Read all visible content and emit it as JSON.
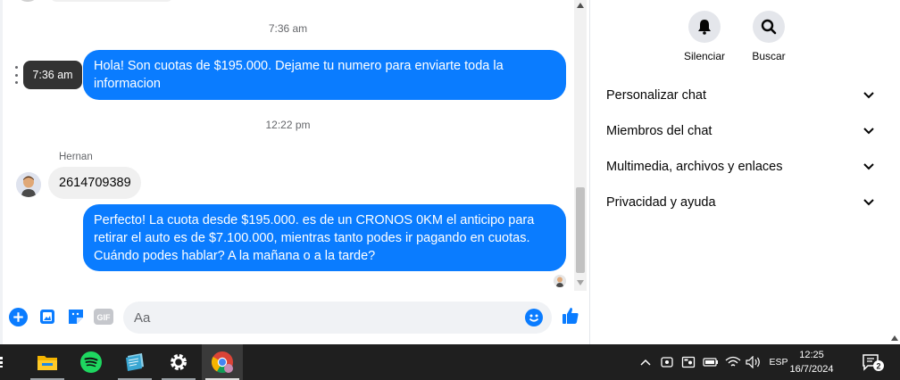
{
  "chat": {
    "messages": [
      {
        "type": "timestamp",
        "text": "7:36 am"
      },
      {
        "type": "outgoing",
        "text": "Hola! Son cuotas de $195.000. Dejame tu numero para enviarte toda la informacion"
      },
      {
        "type": "timestamp",
        "text": "12:22 pm"
      },
      {
        "type": "incoming",
        "sender": "Hernan",
        "text": "2614709389"
      },
      {
        "type": "outgoing",
        "text": "Perfecto! La cuota desde $195.000. es de un CRONOS 0KM el anticipo para retirar el auto es de $7.100.000, mientras tanto podes ir pagando en cuotas. Cuándo podes hablar? A la mañana o a la tarde?"
      }
    ],
    "hover_tooltip": "7:36 am"
  },
  "composer": {
    "placeholder": "Aa",
    "icons": [
      "plus-circle-icon",
      "image-icon",
      "sticker-icon",
      "gif-icon",
      "emoji-icon",
      "thumbs-up-icon"
    ],
    "gif_label": "GIF"
  },
  "right_panel": {
    "actions": [
      {
        "icon": "bell-icon",
        "label": "Silenciar"
      },
      {
        "icon": "search-icon",
        "label": "Buscar"
      }
    ],
    "sections": [
      {
        "label": "Personalizar chat"
      },
      {
        "label": "Miembros del chat"
      },
      {
        "label": "Multimedia, archivos y enlaces"
      },
      {
        "label": "Privacidad y ayuda"
      }
    ]
  },
  "taskbar": {
    "apps": [
      "task-view-icon",
      "file-explorer-icon",
      "spotify-icon",
      "notes-app-icon",
      "settings-icon",
      "chrome-icon"
    ],
    "tray": {
      "language": "ESP",
      "time": "12:25",
      "date": "16/7/2024",
      "notification_count": "2"
    }
  },
  "colors": {
    "accent": "#0a7cff",
    "incoming_bubble": "#f0f0f0",
    "taskbar": "#1f1f1f"
  }
}
